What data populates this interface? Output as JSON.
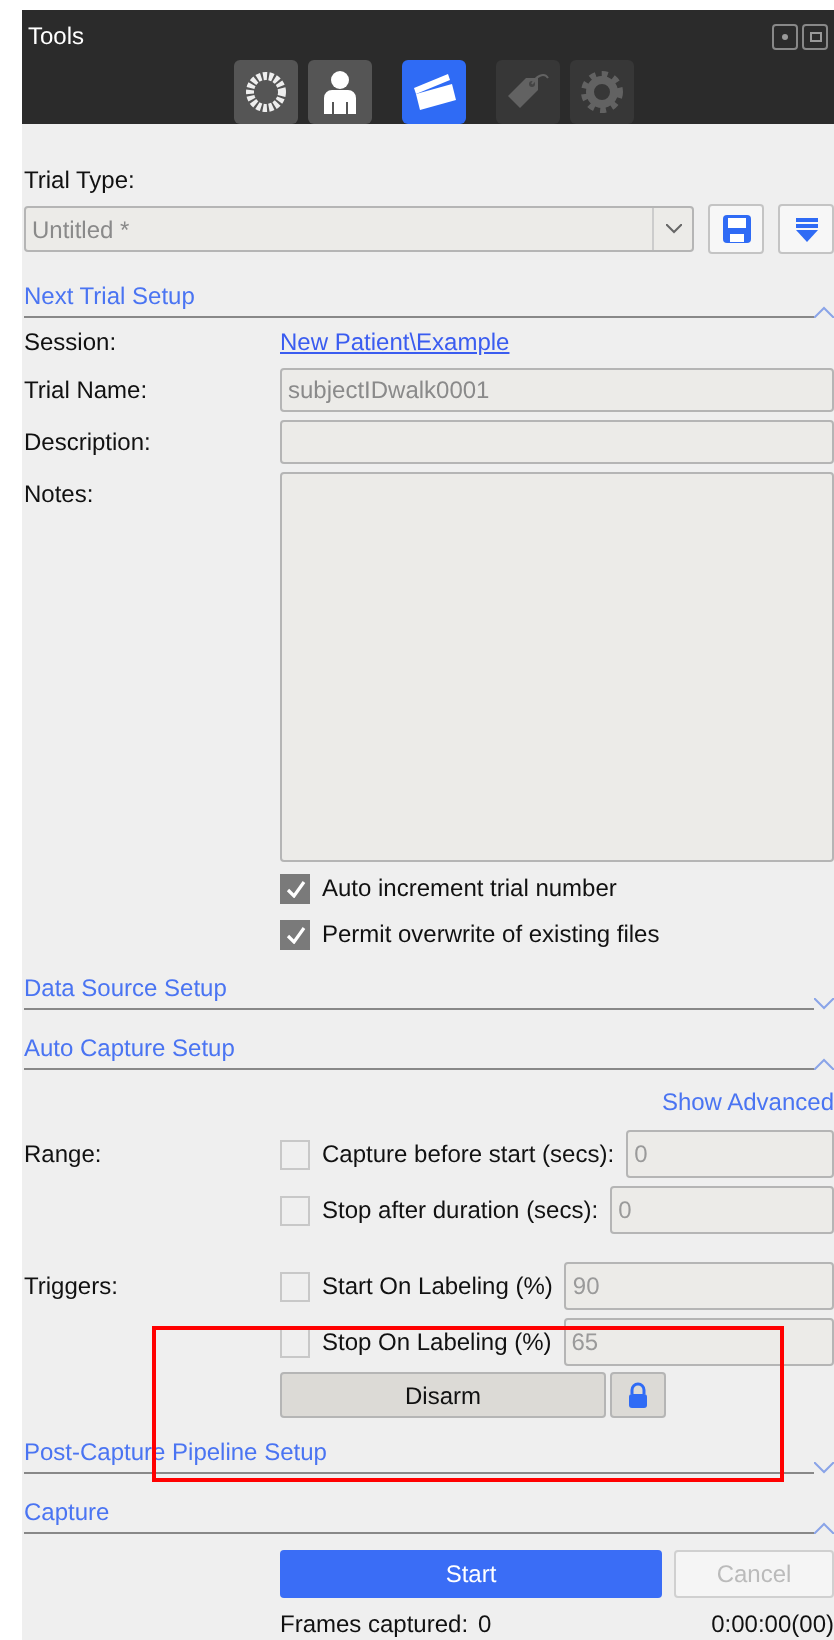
{
  "window": {
    "title": "Tools"
  },
  "toolbar": [
    {
      "kind": "markers",
      "selected": false,
      "disabled": false
    },
    {
      "kind": "subject",
      "selected": false,
      "disabled": false
    },
    {
      "kind": "capture",
      "selected": true,
      "disabled": false
    },
    {
      "kind": "label",
      "selected": false,
      "disabled": true
    },
    {
      "kind": "settings",
      "selected": false,
      "disabled": true
    }
  ],
  "trial_type": {
    "label": "Trial Type:",
    "value": "Untitled *"
  },
  "next_trial_setup": {
    "title": "Next Trial Setup",
    "expanded": true,
    "session": {
      "label": "Session:",
      "value": "New Patient\\Example"
    },
    "trial_name": {
      "label": "Trial Name:",
      "value": "subjectIDwalk0001"
    },
    "description": {
      "label": "Description:"
    },
    "notes": {
      "label": "Notes:"
    },
    "options": [
      {
        "label": "Auto increment trial number",
        "checked": true
      },
      {
        "label": "Permit overwrite of existing files",
        "checked": true
      }
    ]
  },
  "data_source_setup": {
    "title": "Data Source Setup",
    "expanded": false
  },
  "auto_capture_setup": {
    "title": "Auto Capture Setup",
    "expanded": true,
    "show_advanced": "Show Advanced",
    "groups": [
      {
        "label": "Range:",
        "rows": [
          {
            "label": "Capture before start (secs):",
            "checked": false,
            "value": "0"
          },
          {
            "label": "Stop after duration (secs):",
            "checked": false,
            "value": "0"
          }
        ]
      },
      {
        "label": "Triggers:",
        "rows": [
          {
            "label": "Start On Labeling (%)",
            "checked": false,
            "value": "90"
          },
          {
            "label": "Stop On Labeling (%)",
            "checked": false,
            "value": "65"
          }
        ]
      }
    ],
    "arm_button": "Disarm"
  },
  "post_capture_pipeline_setup": {
    "title": "Post-Capture Pipeline Setup",
    "expanded": false
  },
  "capture": {
    "title": "Capture",
    "expanded": true,
    "start": "Start",
    "cancel": "Cancel",
    "frames_label": "Frames captured:",
    "frames": "0",
    "time": "0:00:00(00)"
  }
}
